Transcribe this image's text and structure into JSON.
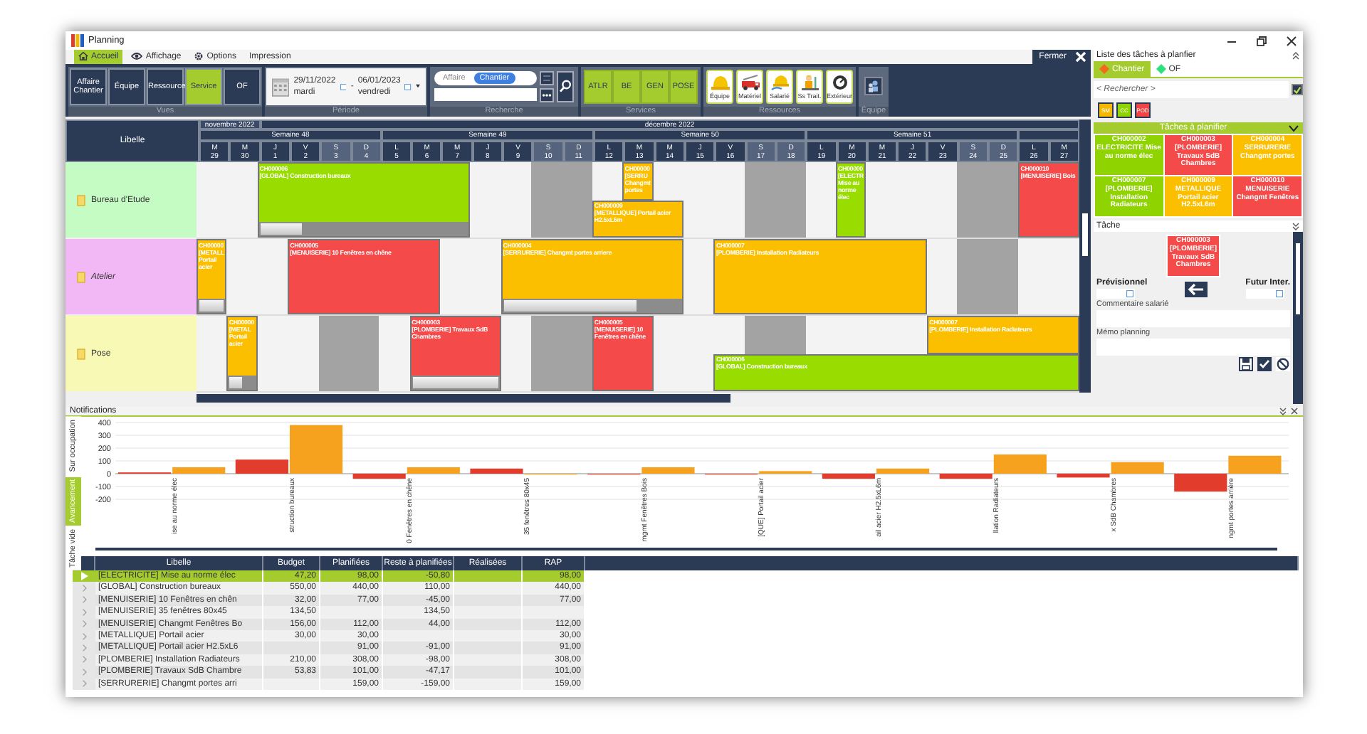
{
  "window": {
    "title": "Planning"
  },
  "menu": [
    {
      "label": "Accueil",
      "kind": "home",
      "selected": true
    },
    {
      "label": "Affichage",
      "kind": "eye",
      "selected": false
    },
    {
      "label": "Options",
      "kind": "gear",
      "selected": false
    },
    {
      "label": "Impression",
      "kind": "text",
      "selected": false
    }
  ],
  "close_button": "Fermer",
  "ribbon": {
    "views": {
      "caption": "Vues",
      "buttons": [
        {
          "label": "Affaire Chantier",
          "selected": false
        },
        {
          "label": "Équipe",
          "selected": false
        },
        {
          "label": "Ressource",
          "selected": false
        },
        {
          "label": "Service",
          "selected": true
        },
        {
          "label": "OF",
          "selected": false
        }
      ]
    },
    "period": {
      "caption": "Période",
      "start": {
        "date": "29/11/2022",
        "day": "mardi"
      },
      "separator": "-",
      "end": {
        "date": "06/01/2023",
        "day": "vendredi"
      }
    },
    "search": {
      "caption": "Recherche",
      "options": [
        {
          "label": "Affaire",
          "selected": false
        },
        {
          "label": "Chantier",
          "selected": true
        }
      ]
    },
    "services": {
      "caption": "Services",
      "buttons": [
        "ATLR",
        "BE",
        "GEN",
        "POSE"
      ]
    },
    "resources": {
      "caption": "Ressources",
      "buttons": [
        {
          "label": "Équipe",
          "kind": "helmet"
        },
        {
          "label": "Matériel",
          "kind": "truck"
        },
        {
          "label": "Salarié",
          "kind": "worker"
        },
        {
          "label": "Ss Trait.",
          "kind": "contractor"
        },
        {
          "label": "Extérieur",
          "kind": "dial"
        }
      ]
    },
    "team": {
      "caption": "Équipe"
    }
  },
  "gantt": {
    "label_header": "Libelle",
    "months": [
      {
        "label": "novembre 2022"
      },
      {
        "label": "décembre 2022"
      }
    ],
    "weeks": [
      {
        "label": "Semaine 48"
      },
      {
        "label": "Semaine 49"
      },
      {
        "label": "Semaine 50"
      },
      {
        "label": "Semaine 51"
      }
    ],
    "days": [
      {
        "dow": "M",
        "day": "29",
        "weekend": false
      },
      {
        "dow": "M",
        "day": "30",
        "weekend": false
      },
      {
        "dow": "J",
        "day": "1",
        "weekend": false
      },
      {
        "dow": "V",
        "day": "2",
        "weekend": false
      },
      {
        "dow": "S",
        "day": "3",
        "weekend": true
      },
      {
        "dow": "D",
        "day": "4",
        "weekend": true
      },
      {
        "dow": "L",
        "day": "5",
        "weekend": false
      },
      {
        "dow": "M",
        "day": "6",
        "weekend": false
      },
      {
        "dow": "M",
        "day": "7",
        "weekend": false
      },
      {
        "dow": "J",
        "day": "8",
        "weekend": false
      },
      {
        "dow": "V",
        "day": "9",
        "weekend": false
      },
      {
        "dow": "S",
        "day": "10",
        "weekend": true
      },
      {
        "dow": "D",
        "day": "11",
        "weekend": true
      },
      {
        "dow": "L",
        "day": "12",
        "weekend": false
      },
      {
        "dow": "M",
        "day": "13",
        "weekend": false
      },
      {
        "dow": "M",
        "day": "14",
        "weekend": false
      },
      {
        "dow": "J",
        "day": "15",
        "weekend": false
      },
      {
        "dow": "V",
        "day": "16",
        "weekend": false
      },
      {
        "dow": "S",
        "day": "17",
        "weekend": true
      },
      {
        "dow": "D",
        "day": "18",
        "weekend": true
      },
      {
        "dow": "L",
        "day": "19",
        "weekend": false
      },
      {
        "dow": "M",
        "day": "20",
        "weekend": false
      },
      {
        "dow": "M",
        "day": "21",
        "weekend": false
      },
      {
        "dow": "J",
        "day": "22",
        "weekend": false
      },
      {
        "dow": "V",
        "day": "23",
        "weekend": false
      },
      {
        "dow": "S",
        "day": "24",
        "weekend": true
      },
      {
        "dow": "D",
        "day": "25",
        "weekend": true
      },
      {
        "dow": "L",
        "day": "26",
        "weekend": false
      },
      {
        "dow": "M",
        "day": "27",
        "weekend": false
      }
    ],
    "lanes": [
      {
        "label": "Bureau d'Etude",
        "color": "#c4fcc4",
        "bars": [
          {
            "code": "CH000006",
            "text": "[GLOBAL] Construction bureaux",
            "color": "#99dd00",
            "level": 0.2
          },
          {
            "code": "CH00000",
            "text": "[SERRU Changmt portes",
            "color": "#fcbf00"
          },
          {
            "code": "CH000009",
            "text": "[METALLIQUE] Portail acier H2.5xL6m",
            "color": "#fcbf00"
          },
          {
            "code": "CH00000",
            "text": "[ELECTR Mise au norme élec",
            "color": "#99dd00"
          },
          {
            "code": "CH000010",
            "text": "[MENUISERIE] Bois",
            "color": "#f44a4a"
          }
        ]
      },
      {
        "label": "Atelier",
        "color": "#f2b8f6",
        "bars": [
          {
            "code": "CH00000",
            "text": "[METALL Portail acier",
            "color": "#fcbf00",
            "level": 1
          },
          {
            "code": "CH000005",
            "text": "[MENUISERIE] 10 Fenêtres en chêne",
            "color": "#f44a4a"
          },
          {
            "code": "CH000004",
            "text": "[SERRURERIE] Changmt portes arriere",
            "color": "#fcbf00",
            "level": 0.75
          },
          {
            "code": "CH000007",
            "text": "[PLOMBERIE] Installation Radiateurs",
            "color": "#fcbf00"
          }
        ]
      },
      {
        "label": "Pose",
        "color": "#f7f9b4",
        "bars": [
          {
            "code": "CH00000",
            "text": "[METAL Portail acier",
            "color": "#fcbf00",
            "level": 0.5
          },
          {
            "code": "CH000003",
            "text": "[PLOMBERIE] Travaux SdB Chambres",
            "color": "#f44a4a",
            "level": 1
          },
          {
            "code": "CH000005",
            "text": "[MENUISERIE] 10 Fenêtres en chêne",
            "color": "#f44a4a"
          },
          {
            "code": "CH000007",
            "text": "[PLOMBERIE] Installation Radiateurs",
            "color": "#fcbf00"
          },
          {
            "code": "CH000006",
            "text": "[GLOBAL] Construction bureaux",
            "color": "#99dd00"
          }
        ]
      }
    ]
  },
  "task_panel": {
    "title": "Liste des tâches à planfier",
    "tabs": [
      {
        "label": "Chantier",
        "selected": true,
        "color": "#f26b1d"
      },
      {
        "label": "OF",
        "selected": false,
        "color": "#2ee07a"
      }
    ],
    "search": {
      "placeholder": "< Rechercher >",
      "checked": true
    },
    "tags": [
      {
        "label": "SM",
        "color": "#f5b800"
      },
      {
        "label": "CC",
        "color": "#8fd400"
      },
      {
        "label": "POD",
        "color": "#f24444"
      }
    ],
    "section": "Tâches à planifier",
    "cards": [
      {
        "code": "CH000002",
        "text": "ELECTRICITE Mise au norme élec",
        "color": "#8fd400"
      },
      {
        "code": "CH000003",
        "text": "[PLOMBERIE] Travaux SdB Chambres",
        "color": "#f44a4a"
      },
      {
        "code": "CH000004",
        "text": "SERRURERIE Changmt portes",
        "color": "#fcbf00"
      },
      {
        "code": "CH000007",
        "text": "[PLOMBERIE] Installation Radiateurs",
        "color": "#8fd400"
      },
      {
        "code": "CH000009",
        "text": "METALLIQUE Portail acier H2.5xL6m",
        "color": "#fcbf00"
      },
      {
        "code": "CH000010",
        "text": "MENUISERIE Changmt Fenêtres",
        "color": "#f44a4a"
      }
    ],
    "task_section": "Tâche",
    "task": {
      "code": "CH000003",
      "text": "[PLOMBERIE] Travaux SdB Chambres",
      "color": "#f44a4a"
    },
    "planned_label": "Prévisionnel",
    "future_label": "Futur Inter.",
    "comment_label": "Commentaire salarié",
    "memo_label": "Mémo planning"
  },
  "notifications": {
    "title": "Notifications",
    "tabs": [
      {
        "label": "Tâche vide",
        "selected": false
      },
      {
        "label": "Avancement",
        "selected": true
      },
      {
        "label": "Sur occupation",
        "selected": false
      }
    ],
    "chart_data": {
      "type": "bar",
      "grid": true,
      "categories": [
        "ise au norme élec",
        "struction bureaux",
        "0 Fenêtres en chêne",
        "35 fenêtres 80x45",
        "mgmt Fenêtres Bois",
        "[QUE] Portail acier",
        "ail acier H2.5xL6m",
        "llation Radiateurs",
        "x SdB Chambres",
        "ngmt portes arrière"
      ],
      "series": [
        {
          "color": "#e23c2c",
          "values": [
            10,
            110,
            -40,
            40,
            0,
            0,
            -40,
            -40,
            -30,
            -140
          ]
        },
        {
          "color": "#f7a21e",
          "values": [
            50,
            380,
            50,
            0,
            50,
            20,
            40,
            150,
            90,
            140
          ]
        }
      ],
      "ylim": [
        -200,
        400
      ],
      "yticks": [
        -200,
        -100,
        0,
        100,
        200,
        300,
        400
      ]
    }
  },
  "table": {
    "columns": [
      "Libelle",
      "Budget",
      "Planifiées",
      "Reste à planifiées",
      "Réalisées",
      "RAP"
    ],
    "rows": [
      {
        "selected": true,
        "cells": [
          "[ELECTRICITE] Mise au norme élec",
          "47,20",
          "98,00",
          "-50,80",
          null,
          "98,00"
        ]
      },
      {
        "selected": false,
        "cells": [
          "[GLOBAL] Construction bureaux",
          "550,00",
          "440,00",
          "110,00",
          null,
          "440,00"
        ]
      },
      {
        "selected": false,
        "cells": [
          "[MENUISERIE] 10 Fenêtres en chên",
          "32,00",
          "77,00",
          "-45,00",
          null,
          "77,00"
        ]
      },
      {
        "selected": false,
        "cells": [
          "[MENUISERIE] 35 fenêtres 80x45",
          "134,50",
          null,
          "134,50",
          null,
          null
        ]
      },
      {
        "selected": false,
        "cells": [
          "[MENUISERIE] Changmt Fenêtres Bo",
          "156,00",
          "112,00",
          "44,00",
          null,
          "112,00"
        ]
      },
      {
        "selected": false,
        "cells": [
          "[METALLIQUE] Portail acier",
          "30,00",
          "30,00",
          null,
          null,
          "30,00"
        ]
      },
      {
        "selected": false,
        "cells": [
          "[METALLIQUE] Portail acier H2.5xL6",
          null,
          "91,00",
          "-91,00",
          null,
          "91,00"
        ]
      },
      {
        "selected": false,
        "cells": [
          "[PLOMBERIE] Installation Radiateurs",
          "210,00",
          "308,00",
          "-98,00",
          null,
          "308,00"
        ]
      },
      {
        "selected": false,
        "cells": [
          "[PLOMBERIE] Travaux SdB Chambre",
          "53,83",
          "101,00",
          "-47,17",
          null,
          "101,00"
        ]
      },
      {
        "selected": false,
        "cells": [
          "[SERRURERIE] Changmt portes arri",
          null,
          "159,00",
          "-159,00",
          null,
          "159,00"
        ]
      }
    ]
  }
}
